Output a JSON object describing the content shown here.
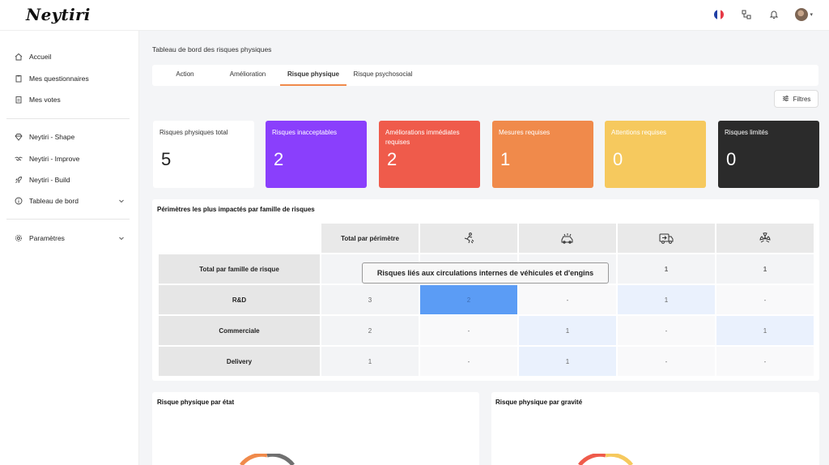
{
  "app": {
    "logo": "Neytiri"
  },
  "topbar": {
    "flag_colors": [
      "#1f3fa5",
      "#ffffff",
      "#e63946"
    ],
    "icons": [
      "france-flag-icon",
      "network-icon",
      "bell-icon",
      "avatar"
    ]
  },
  "sidebar": {
    "items": [
      {
        "label": "Accueil",
        "icon": "home-icon"
      },
      {
        "label": "Mes questionnaires",
        "icon": "clipboard-icon"
      },
      {
        "label": "Mes votes",
        "icon": "ballot-icon"
      },
      {
        "label": "Neytiri - Shape",
        "icon": "gem-icon"
      },
      {
        "label": "Neytiri - Improve",
        "icon": "handshake-icon"
      },
      {
        "label": "Neytiri - Build",
        "icon": "rocket-icon"
      },
      {
        "label": "Tableau de bord",
        "icon": "info-icon"
      },
      {
        "label": "Paramètres",
        "icon": "gear-icon"
      }
    ]
  },
  "main": {
    "breadcrumb": "Tableau de bord des risques physiques",
    "tabs": [
      "Action",
      "Amélioration",
      "Risque physique",
      "Risque psychosocial"
    ],
    "active_tab": "Risque physique",
    "filter_label": "Filtres",
    "kpis": [
      {
        "label": "Risques physiques total",
        "value": "5",
        "bg": "#ffffff",
        "fg": "#222222"
      },
      {
        "label": "Risques inacceptables",
        "value": "2",
        "bg": "#8a3ffc",
        "fg": "#ffffff"
      },
      {
        "label": "Améliorations immédiates requises",
        "value": "2",
        "bg": "#ef5b4b",
        "fg": "#ffffff"
      },
      {
        "label": "Mesures requises",
        "value": "1",
        "bg": "#f08a4b",
        "fg": "#ffffff"
      },
      {
        "label": "Attentions requises",
        "value": "0",
        "bg": "#f6c95e",
        "fg": "#ffffff"
      },
      {
        "label": "Risques limités",
        "value": "0",
        "bg": "#2b2b2b",
        "fg": "#ffffff"
      }
    ],
    "impact_table": {
      "title": "Périmètres les plus impactés par famille de risques",
      "col_header_total": "Total par périmètre",
      "col_icons": [
        "falling-person-icon",
        "vehicle-collision-icon",
        "truck-icon",
        "radiation-icon"
      ],
      "rows": [
        {
          "label": "Total par famille de risque",
          "values": [
            "",
            "",
            "",
            "1",
            "1"
          ]
        },
        {
          "label": "R&D",
          "values": [
            "3",
            "2",
            "-",
            "1",
            "-"
          ]
        },
        {
          "label": "Commerciale",
          "values": [
            "2",
            "-",
            "1",
            "-",
            "1"
          ]
        },
        {
          "label": "Delivery",
          "values": [
            "1",
            "-",
            "1",
            "-",
            "-"
          ]
        }
      ],
      "tooltip": "Risques liés aux circulations internes de véhicules et d'engins",
      "highlight_color": "#5b9cf5",
      "light_color": "#eaf1fd"
    },
    "chart_state_title": "Risque physique par état",
    "chart_gravity_title": "Risque physique par gravité",
    "donut_colors_state": [
      "#f08a4b",
      "#707070"
    ],
    "donut_colors_gravity": [
      "#ef5b4b",
      "#f6c95e"
    ]
  }
}
